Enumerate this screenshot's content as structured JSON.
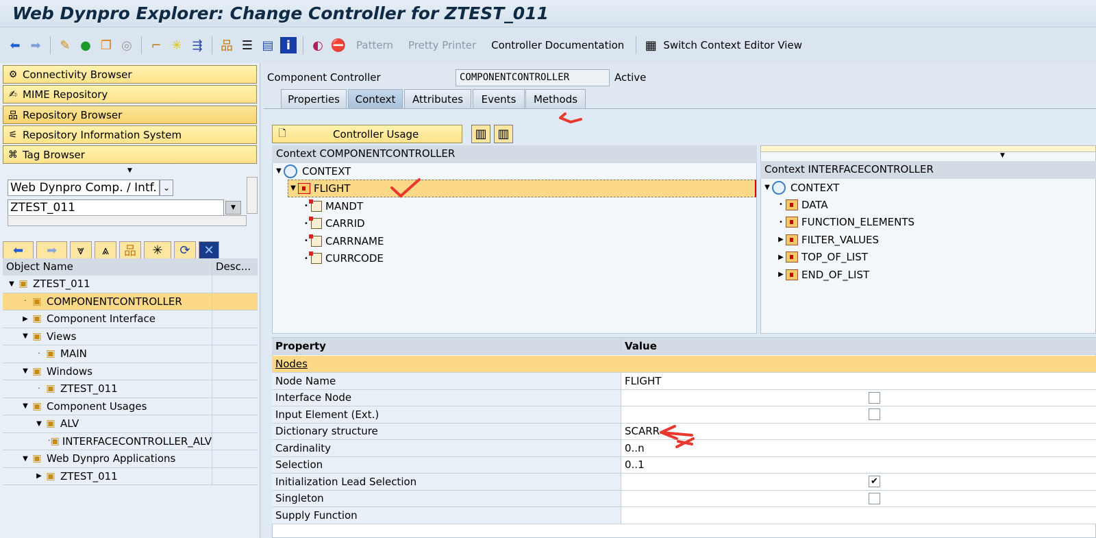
{
  "title": "Web Dynpro Explorer: Change Controller for ZTEST_011",
  "toolbar": {
    "icons": [
      "back-arrow-icon",
      "forward-arrow-icon",
      "edit-pencil-icon",
      "activate-icon",
      "copy-icon",
      "where-used-icon",
      "hierarchy-up-icon",
      "wand-icon",
      "navigate-icon",
      "object-tree-icon",
      "stack-icon",
      "layout-icon",
      "info-icon",
      "test-icon",
      "stop-icon"
    ],
    "pattern": "Pattern",
    "pretty_printer": "Pretty Printer",
    "controller_documentation": "Controller Documentation",
    "switch_context": "Switch Context Editor View"
  },
  "left": {
    "nav_buttons": [
      "Connectivity Browser",
      "MIME Repository",
      "Repository Browser",
      "Repository Information System",
      "Tag Browser"
    ],
    "object_type": "Web Dynpro Comp. / Intf.",
    "object_name": "ZTEST_011",
    "columns": [
      "Object Name",
      "Desc..."
    ],
    "tree": [
      {
        "label": "ZTEST_011",
        "level": 0,
        "expander": "open"
      },
      {
        "label": "COMPONENTCONTROLLER",
        "level": 1,
        "expander": "leaf",
        "selected": true
      },
      {
        "label": "Component Interface",
        "level": 1,
        "expander": "closed"
      },
      {
        "label": "Views",
        "level": 1,
        "expander": "open"
      },
      {
        "label": "MAIN",
        "level": 2,
        "expander": "leaf"
      },
      {
        "label": "Windows",
        "level": 1,
        "expander": "open"
      },
      {
        "label": "ZTEST_011",
        "level": 2,
        "expander": "leaf"
      },
      {
        "label": "Component Usages",
        "level": 1,
        "expander": "open"
      },
      {
        "label": "ALV",
        "level": 2,
        "expander": "open"
      },
      {
        "label": "INTERFACECONTROLLER_ALV",
        "level": 3,
        "expander": "leaf"
      },
      {
        "label": "Web Dynpro Applications",
        "level": 1,
        "expander": "open"
      },
      {
        "label": "ZTEST_011",
        "level": 2,
        "expander": "closed"
      }
    ]
  },
  "main": {
    "controller_label": "Component Controller",
    "controller_name": "COMPONENTCONTROLLER",
    "status": "Active",
    "tabs": [
      {
        "label": "Properties"
      },
      {
        "label": "Context",
        "active": true
      },
      {
        "label": "Attributes"
      },
      {
        "label": "Events"
      },
      {
        "label": "Methods"
      }
    ],
    "controller_usage": "Controller Usage",
    "left_context": {
      "header": "Context COMPONENTCONTROLLER",
      "root": "CONTEXT",
      "node": "FLIGHT",
      "attributes": [
        "MANDT",
        "CARRID",
        "CARRNAME",
        "CURRCODE"
      ]
    },
    "right_context": {
      "header": "Context INTERFACECONTROLLER",
      "root": "CONTEXT",
      "nodes": [
        {
          "label": "DATA",
          "expander": "leaf"
        },
        {
          "label": "FUNCTION_ELEMENTS",
          "expander": "leaf"
        },
        {
          "label": "FILTER_VALUES",
          "expander": "closed"
        },
        {
          "label": "TOP_OF_LIST",
          "expander": "closed"
        },
        {
          "label": "END_OF_LIST",
          "expander": "closed"
        }
      ]
    },
    "properties": {
      "columns": [
        "Property",
        "Value"
      ],
      "section": "Nodes",
      "rows": [
        {
          "name": "Node Name",
          "value": "FLIGHT"
        },
        {
          "name": "Interface Node",
          "checkbox": false
        },
        {
          "name": "Input Element (Ext.)",
          "checkbox": false
        },
        {
          "name": "Dictionary structure",
          "value": "SCARR"
        },
        {
          "name": "Cardinality",
          "value": "0..n"
        },
        {
          "name": "Selection",
          "value": "0..1"
        },
        {
          "name": "Initialization Lead Selection",
          "checkbox": true
        },
        {
          "name": "Singleton",
          "checkbox": false
        },
        {
          "name": "Supply Function",
          "value": ""
        }
      ]
    }
  },
  "colors": {
    "selection": "#fbd987",
    "annotation": "#e8392e",
    "button": "#fde28a"
  }
}
